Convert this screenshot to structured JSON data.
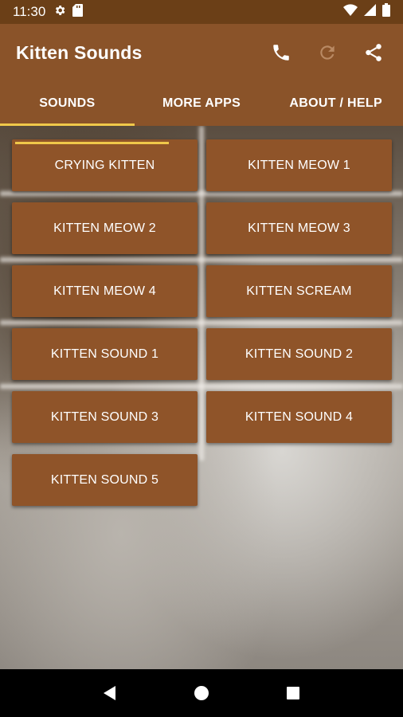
{
  "status_bar": {
    "time": "11:30",
    "left_icons": [
      "gear-icon",
      "sd-card-icon"
    ],
    "right_icons": [
      "wifi-icon",
      "signal-icon",
      "battery-icon"
    ]
  },
  "app_bar": {
    "title": "Kitten Sounds",
    "actions": [
      "phone-icon",
      "refresh-icon",
      "share-icon"
    ]
  },
  "tabs": [
    {
      "label": "SOUNDS",
      "active": true
    },
    {
      "label": "MORE APPS",
      "active": false
    },
    {
      "label": "ABOUT / HELP",
      "active": false
    }
  ],
  "sounds": [
    {
      "label": "CRYING KITTEN",
      "progress": 0.83
    },
    {
      "label": "KITTEN MEOW 1"
    },
    {
      "label": "KITTEN MEOW 2"
    },
    {
      "label": "KITTEN MEOW 3"
    },
    {
      "label": "KITTEN MEOW 4"
    },
    {
      "label": "KITTEN SCREAM"
    },
    {
      "label": "KITTEN SOUND 1"
    },
    {
      "label": "KITTEN SOUND 2"
    },
    {
      "label": "KITTEN SOUND 3"
    },
    {
      "label": "KITTEN SOUND 4"
    },
    {
      "label": "KITTEN SOUND 5"
    }
  ],
  "colors": {
    "status_bar": "#6b3f17",
    "primary": "#8a5329",
    "button": "#8f5429",
    "accent": "#f0c84a"
  }
}
